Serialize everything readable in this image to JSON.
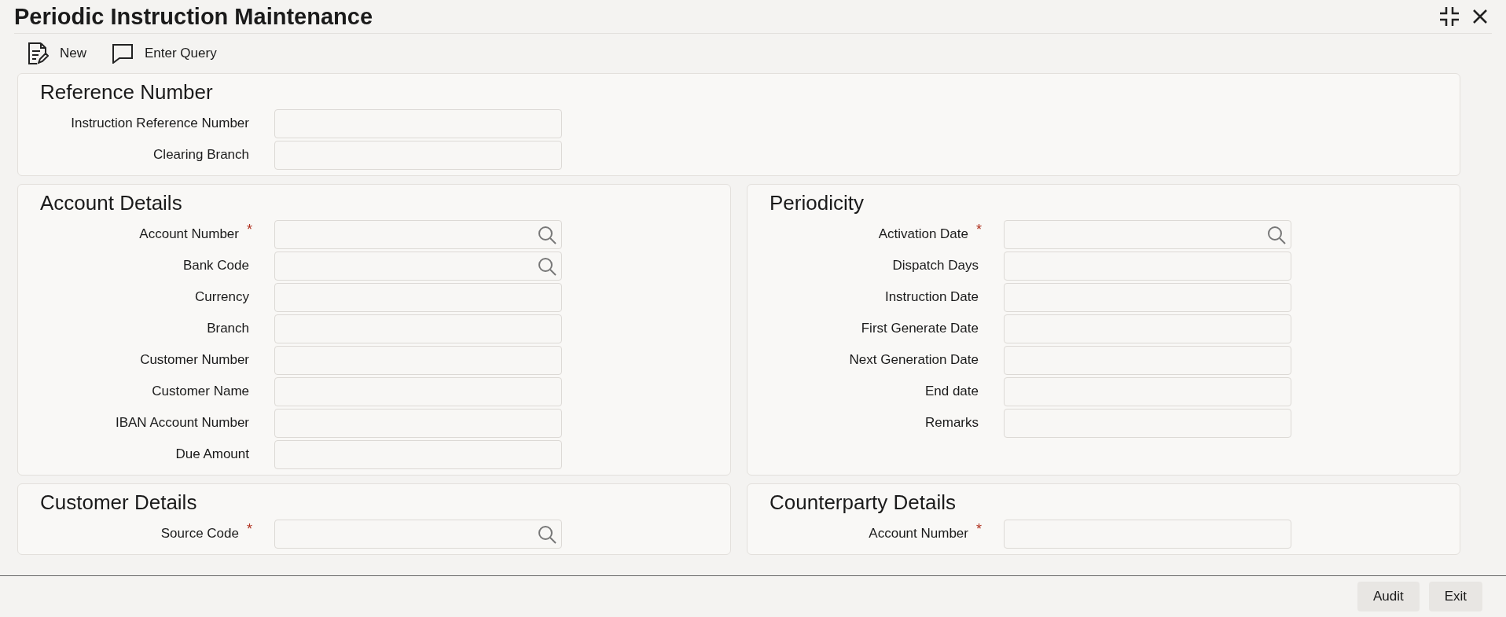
{
  "window": {
    "title": "Periodic Instruction Maintenance"
  },
  "toolbar": [
    {
      "label": "New",
      "kind": "new"
    },
    {
      "label": "Enter Query",
      "kind": "query"
    }
  ],
  "sections": [
    {
      "title": "Reference Number",
      "fields": [
        {
          "label": "Instruction Reference Number",
          "lookup": false
        },
        {
          "label": "Clearing Branch",
          "lookup": false
        }
      ]
    },
    {
      "title": "Account Details",
      "fields": [
        {
          "label": "Account Number",
          "mark": "*",
          "lookup": true
        },
        {
          "label": "Bank Code",
          "lookup": true
        },
        {
          "label": "Currency",
          "lookup": false
        },
        {
          "label": "Branch",
          "lookup": false
        },
        {
          "label": "Customer Number",
          "lookup": false
        },
        {
          "label": "Customer Name",
          "lookup": false
        },
        {
          "label": "IBAN Account Number",
          "lookup": false
        },
        {
          "label": "Due Amount",
          "lookup": false
        }
      ]
    },
    {
      "title": "Periodicity",
      "fields": [
        {
          "label": "Activation Date",
          "mark": "*",
          "lookup": true
        },
        {
          "label": "Dispatch Days",
          "lookup": false
        },
        {
          "label": "Instruction Date",
          "lookup": false
        },
        {
          "label": "First Generate Date",
          "lookup": false
        },
        {
          "label": "Next Generation Date",
          "lookup": false
        },
        {
          "label": "End date",
          "lookup": false
        },
        {
          "label": "Remarks",
          "lookup": false
        }
      ]
    },
    {
      "title": "Customer Details",
      "fields": [
        {
          "label": "Source Code",
          "mark": "*",
          "lookup": true
        }
      ]
    },
    {
      "title": "Counterparty Details",
      "fields": [
        {
          "label": "Account Number",
          "mark": "*",
          "lookup": false
        }
      ]
    }
  ],
  "footer_buttons": [
    "Audit",
    "Exit"
  ]
}
